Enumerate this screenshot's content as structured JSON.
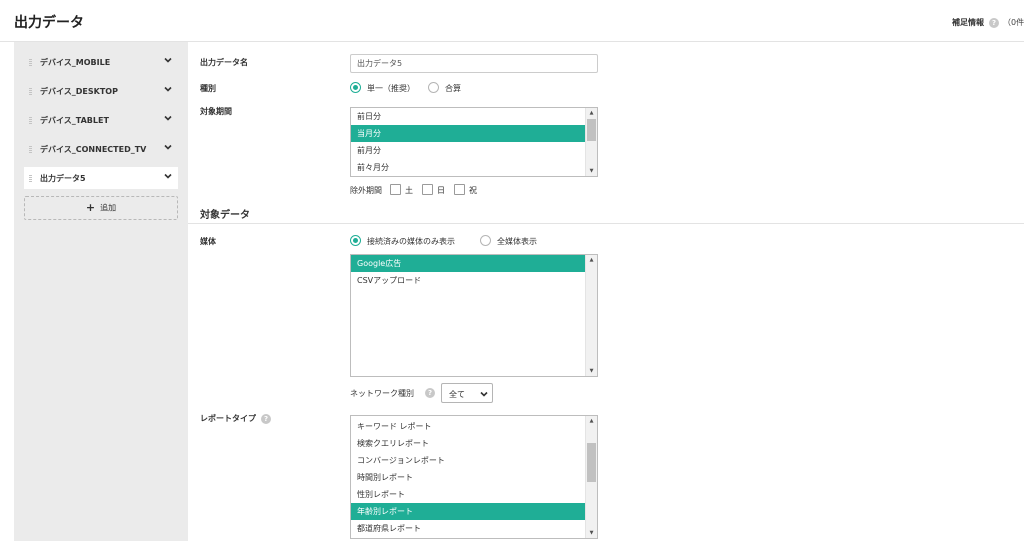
{
  "header": {
    "title": "出力データ",
    "supplementary_label": "補足情報",
    "supplementary_count": "（0件"
  },
  "sidebar": {
    "items": [
      {
        "label": "デバイス_MOBILE"
      },
      {
        "label": "デバイス_DESKTOP"
      },
      {
        "label": "デバイス_TABLET"
      },
      {
        "label": "デバイス_CONNECTED_TV"
      },
      {
        "label": "出力データ5"
      }
    ],
    "add_label": "追加"
  },
  "form": {
    "output_name": {
      "label": "出力データ名",
      "value": "出力データ5"
    },
    "kind": {
      "label": "種別",
      "options": [
        "単一（推奨）",
        "合算"
      ],
      "selected": 0
    },
    "period": {
      "label": "対象期間",
      "options": [
        "前日分",
        "当月分",
        "前月分",
        "前々月分"
      ],
      "selected": 1,
      "exclude_label": "除外期間",
      "exclude_options": [
        "土",
        "日",
        "祝"
      ]
    },
    "target_section_title": "対象データ",
    "media": {
      "label": "媒体",
      "radio_options": [
        "接続済みの媒体のみ表示",
        "全媒体表示"
      ],
      "radio_selected": 0,
      "list": [
        "Google広告",
        "CSVアップロード"
      ],
      "list_selected": 0
    },
    "network": {
      "label": "ネットワーク種別",
      "value": "全て"
    },
    "report_type": {
      "label": "レポートタイプ",
      "options": [
        "キーワード レポート",
        "検索クエリレポート",
        "コンバージョンレポート",
        "時間別レポート",
        "性別レポート",
        "年齢別レポート",
        "都道府県レポート"
      ],
      "selected": 5
    }
  }
}
